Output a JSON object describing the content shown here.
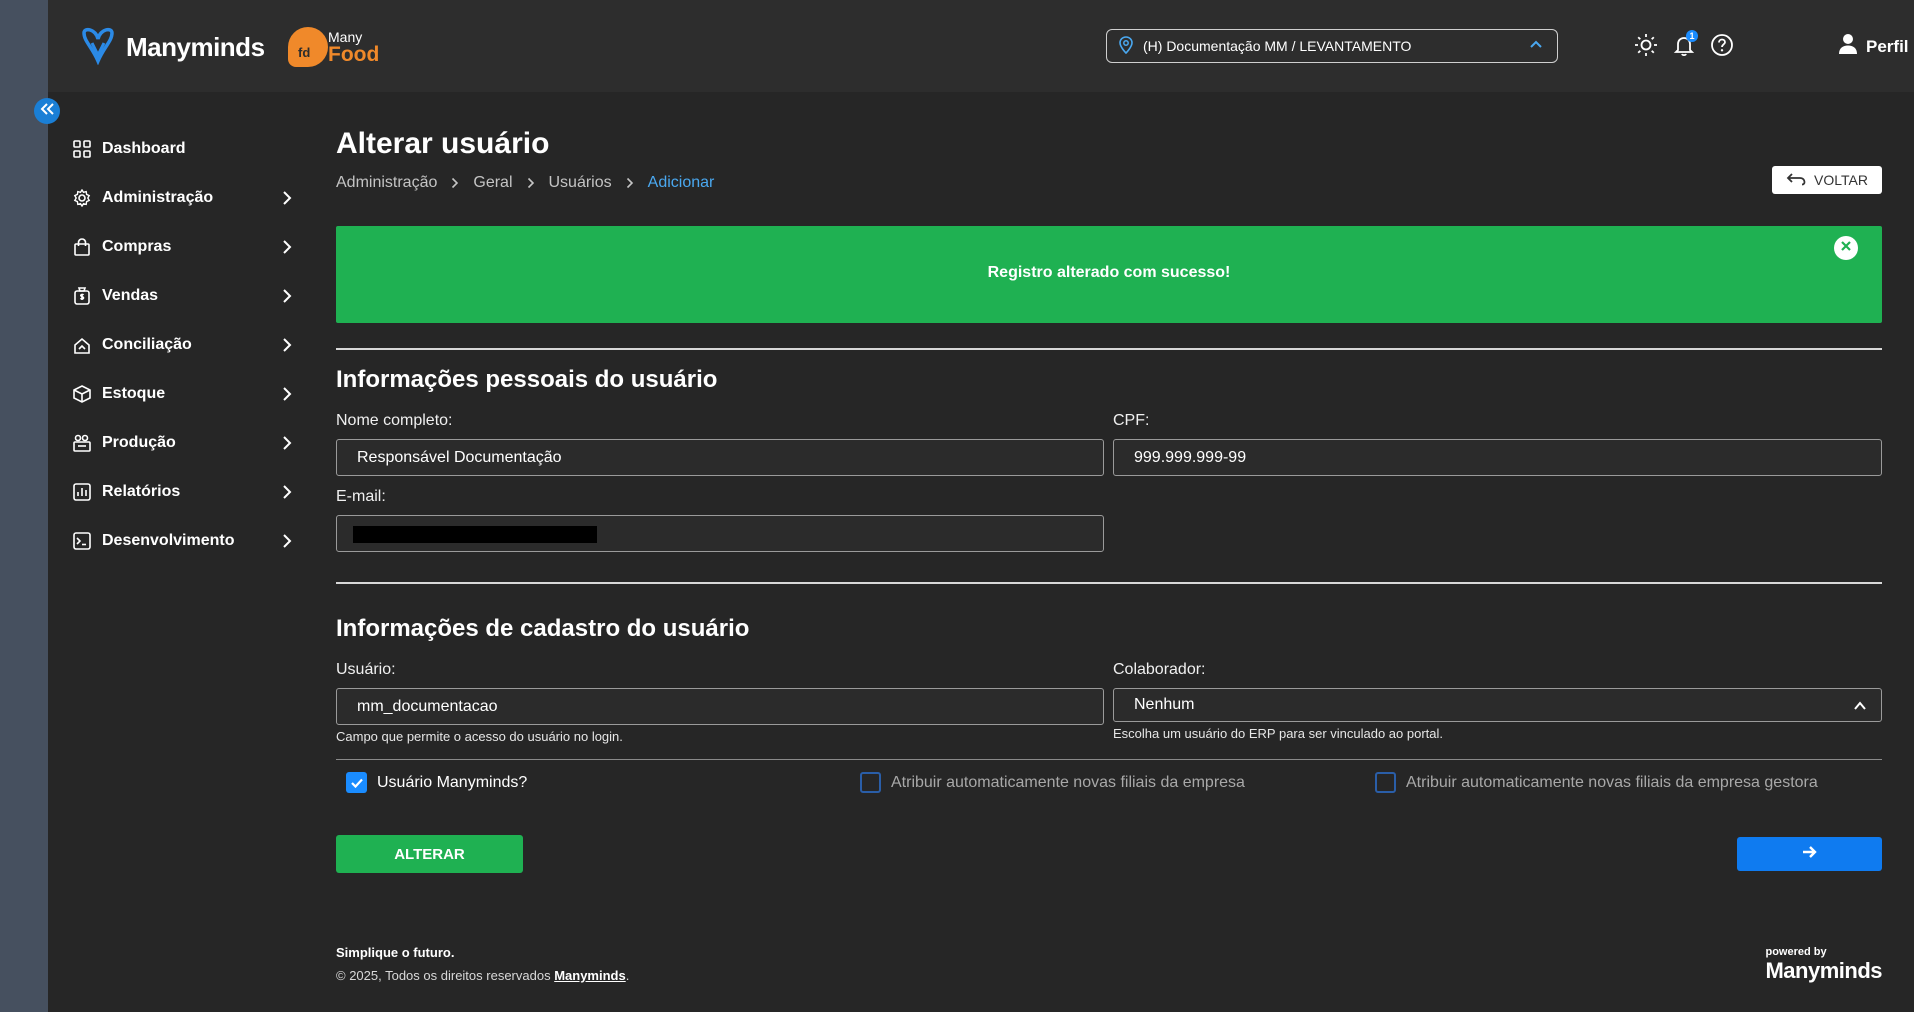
{
  "app": {
    "brand_name": "Manyminds",
    "food_logo_top": "Many",
    "food_logo_bottom": "Food",
    "food_logo_badge": "fd",
    "unit_selector": "(H) Documentação MM / LEVANTAMENTO",
    "notification_count": "1",
    "profile_label": "Perfil"
  },
  "sidebar": {
    "items": [
      {
        "label": "Dashboard",
        "icon": "dashboard-icon"
      },
      {
        "label": "Administração",
        "icon": "gear-icon"
      },
      {
        "label": "Compras",
        "icon": "shopping-bag-icon"
      },
      {
        "label": "Vendas",
        "icon": "money-bag-icon"
      },
      {
        "label": "Conciliação",
        "icon": "reconcile-icon"
      },
      {
        "label": "Estoque",
        "icon": "box-icon"
      },
      {
        "label": "Produção",
        "icon": "factory-icon"
      },
      {
        "label": "Relatórios",
        "icon": "report-icon"
      },
      {
        "label": "Desenvolvimento",
        "icon": "terminal-icon"
      }
    ]
  },
  "page": {
    "title": "Alterar usuário",
    "breadcrumb": [
      "Administração",
      "Geral",
      "Usuários",
      "Adicionar"
    ],
    "back_label": "VOLTAR",
    "alert": "Registro alterado com sucesso!"
  },
  "personal": {
    "title": "Informações pessoais do usuário",
    "name_label": "Nome completo:",
    "name_value": "Responsável Documentação",
    "cpf_label": "CPF:",
    "cpf_value": "999.999.999-99",
    "email_label": "E-mail:"
  },
  "registration": {
    "title": "Informações de cadastro do usuário",
    "user_label": "Usuário:",
    "user_value": "mm_documentacao",
    "user_hint": "Campo que permite o acesso do usuário no login.",
    "collab_label": "Colaborador:",
    "collab_value": "Nenhum",
    "collab_hint": "Escolha um usuário do ERP para ser vinculado ao portal."
  },
  "checks": [
    {
      "label": "Usuário Manyminds?",
      "checked": true
    },
    {
      "label": "Atribuir automaticamente novas filiais da empresa",
      "checked": false
    },
    {
      "label": "Atribuir automaticamente novas filiais da empresa gestora",
      "checked": false
    }
  ],
  "actions": {
    "submit_label": "ALTERAR"
  },
  "footer": {
    "slogan": "Simplique o futuro.",
    "copyright": "© 2025, Todos os direitos reservados",
    "link": "Manyminds",
    "powered_by": "powered by",
    "powered_name": "Manyminds"
  },
  "colors": {
    "accent_blue": "#1a8cff",
    "success_green": "#1fb152",
    "food_orange": "#f0892a"
  }
}
